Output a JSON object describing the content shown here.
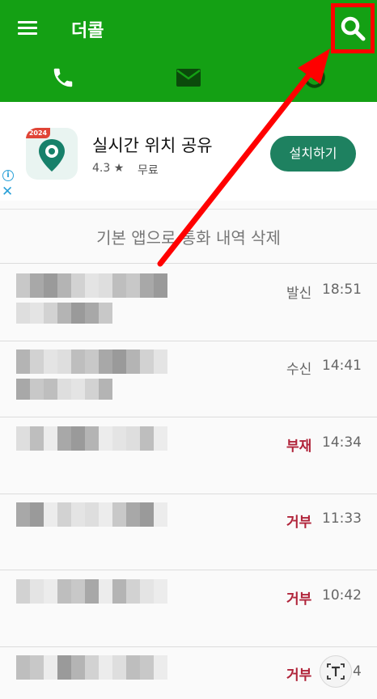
{
  "appbar": {
    "title": "더콜",
    "menu_icon": "hamburger-menu-icon",
    "search_icon": "search-icon",
    "tabs": [
      {
        "icon": "phone-icon"
      },
      {
        "icon": "envelope-icon"
      },
      {
        "icon": "history-icon"
      }
    ]
  },
  "ad": {
    "badge": "2024",
    "title": "실시간 위치 공유",
    "rating": "4.3 ★",
    "price": "무료",
    "install_label": "설치하기",
    "info_icon": "i",
    "close_icon": "✕"
  },
  "delete_banner": "기본 앱으로 통화 내역 삭제",
  "calls": [
    {
      "status": "발신",
      "time": "18:51",
      "status_color": "#666666"
    },
    {
      "status": "수신",
      "time": "14:41",
      "status_color": "#666666"
    },
    {
      "status": "부재",
      "time": "14:34",
      "status_color": "#b0243a"
    },
    {
      "status": "거부",
      "time": "11:33",
      "status_color": "#b0243a"
    },
    {
      "status": "거부",
      "time": "10:42",
      "status_color": "#b0243a"
    },
    {
      "status": "거부",
      "time": "4",
      "status_color": "#b0243a"
    }
  ],
  "colors": {
    "appbar": "#14a014",
    "install_button": "#1e8160",
    "highlight": "#ff0000",
    "missed": "#b0243a"
  }
}
